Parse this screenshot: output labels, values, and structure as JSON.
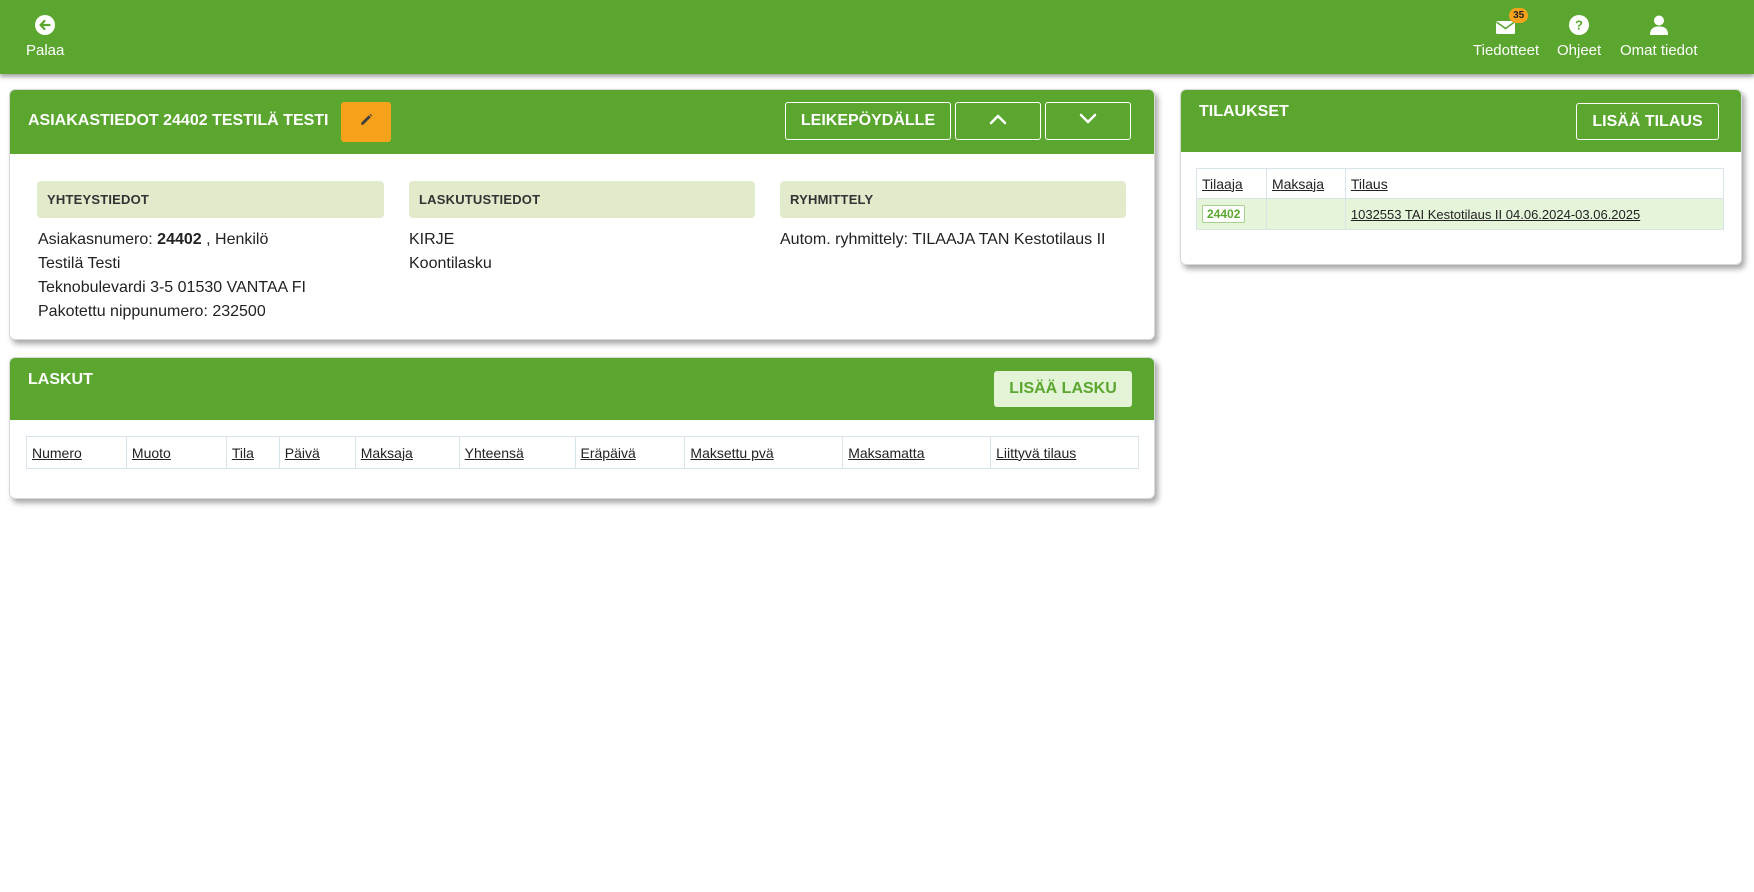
{
  "topbar": {
    "back_label": "Palaa",
    "news_label": "Tiedotteet",
    "news_badge": "35",
    "help_label": "Ohjeet",
    "profile_label": "Omat tiedot"
  },
  "customer": {
    "title": "ASIAKASTIEDOT 24402 TESTILÄ TESTI",
    "clipboard_label": "LEIKEPÖYDÄLLE",
    "contact": {
      "header": "YHTEYSTIEDOT",
      "number_label": "Asiakasnumero:",
      "number_value": "24402",
      "type_suffix": ", Henkilö",
      "name": "Testilä Testi",
      "address": "Teknobulevardi 3-5 01530 VANTAA FI",
      "bundle": "Pakotettu nippunumero: 232500"
    },
    "billing": {
      "header": "LASKUTUSTIEDOT",
      "line1": "KIRJE",
      "line2": "Koontilasku"
    },
    "grouping": {
      "header": "RYHMITTELY",
      "line1": "Autom. ryhmittely: TILAAJA TAN Kestotilaus II"
    }
  },
  "invoices": {
    "title": "LASKUT",
    "add_label": "LISÄÄ LASKU",
    "columns": [
      "Numero",
      "Muoto",
      "Tila",
      "Päivä",
      "Maksaja",
      "Yhteensä",
      "Eräpäivä",
      "Maksettu pvä",
      "Maksamatta",
      "Liittyvä tilaus"
    ]
  },
  "orders": {
    "title": "TILAUKSET",
    "add_label": "LISÄÄ TILAUS",
    "columns": [
      "Tilaaja",
      "Maksaja",
      "Tilaus"
    ],
    "rows": [
      {
        "orderer": "24402",
        "payer": "",
        "order": "1032553 TAI Kestotilaus II 04.06.2024-03.06.2025"
      }
    ]
  },
  "colors": {
    "brand_green": "#5aa62e",
    "edit_orange": "#f7a21b",
    "section_bg": "#e1ebcc",
    "row_highlight": "#e4f5da"
  }
}
